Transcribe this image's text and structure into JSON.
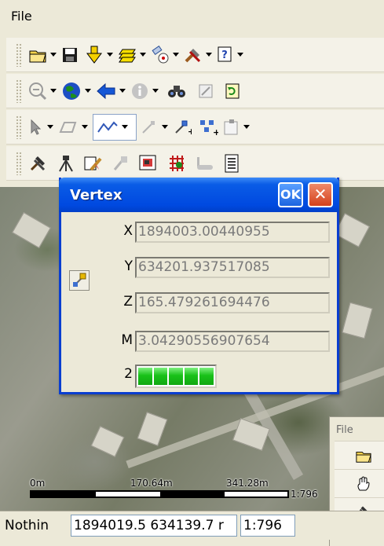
{
  "menu": {
    "file_label": "File"
  },
  "toolbar_icons": {
    "row1": [
      "open-folder-icon",
      "save-icon",
      "add-data-icon",
      "layers-icon",
      "gps-icon",
      "tools-icon",
      "help-icon"
    ],
    "row2": [
      "zoom-icon",
      "globe-icon",
      "back-arrow-icon",
      "info-icon",
      "find-icon",
      "extent-icon",
      "refresh-icon"
    ],
    "row3": [
      "select-arrow-icon",
      "polygon-icon",
      "polyline-icon",
      "vertex-tool-icon",
      "add-vertex-icon",
      "edit-vertices-icon",
      "attributes-icon"
    ],
    "row4": [
      "hammer-wrench-icon",
      "survey-icon",
      "edit-pencil-icon",
      "sketch-icon",
      "map-red-icon",
      "grid-icon",
      "bathtub-icon",
      "document-icon"
    ]
  },
  "dialog": {
    "title": "Vertex",
    "ok_label": "OK",
    "close_label": "✕",
    "fields": [
      {
        "label": "X",
        "value": "1894003.00440955"
      },
      {
        "label": "Y",
        "value": "634201.937517085"
      },
      {
        "label": "Z",
        "value": "165.479261694476"
      },
      {
        "label": "M",
        "value": "3.04290556907654"
      }
    ],
    "quality": {
      "label": "2",
      "filled_blocks": 5,
      "total_blocks": 5
    }
  },
  "map": {
    "scale_labels": [
      "0m",
      "170.64m",
      "341.28m"
    ],
    "scale_ratio": "1:796"
  },
  "statusbar": {
    "message": "Nothin",
    "coordinates": "1894019.5 634139.7 r",
    "scale": "1:796"
  },
  "secondary_window": {
    "file_label": "File"
  }
}
